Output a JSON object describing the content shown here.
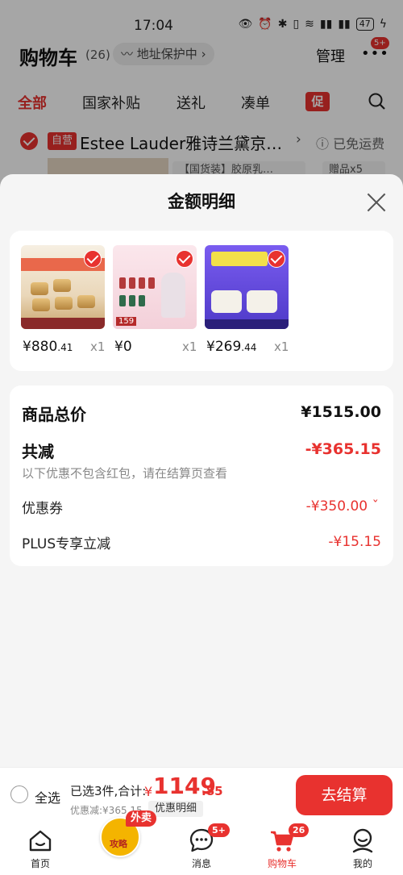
{
  "status_bar": {
    "time": "17:04",
    "battery": "47"
  },
  "header": {
    "title": "购物车",
    "count": "(26)",
    "address_protect": "地址保护中",
    "manage": "管理",
    "more_badge": "5+"
  },
  "filter_tabs": [
    {
      "label": "全部",
      "active": true
    },
    {
      "label": "国家补贴"
    },
    {
      "label": "送礼"
    },
    {
      "label": "凑单"
    }
  ],
  "promo_tag": "促",
  "store": {
    "tag": "自营",
    "name": "Estee Lauder雅诗兰黛京…",
    "shipping": "已免运费",
    "spec": "【国货装】胶原乳…",
    "gift": "赠品x5"
  },
  "sheet": {
    "title": "金额明细",
    "items": [
      {
        "price_int": "¥880",
        "price_dec": ".41",
        "qty": "x1"
      },
      {
        "price_int": "¥0",
        "price_dec": "",
        "qty": "x1"
      },
      {
        "price_int": "¥269",
        "price_dec": ".44",
        "qty": "x1"
      }
    ],
    "total_label": "商品总价",
    "total_value": "¥1515.00",
    "reduction_label": "共减",
    "reduction_value": "-¥365.15",
    "reduction_note": "以下优惠不包含红包，请在结算页查看",
    "coupon_label": "优惠券",
    "coupon_value": "-¥350.00",
    "plus_label": "PLUS专享立减",
    "plus_value": "-¥15.15"
  },
  "checkout": {
    "select_all": "全选",
    "selected_text": "已选3件,合计:",
    "currency": "¥",
    "total_int": "1149",
    "total_dec": ".85",
    "discount_text": "优惠减:¥365.15",
    "detail_label": "优惠明细",
    "button": "去结算"
  },
  "tabbar": {
    "home": "首页",
    "mid_tag": "外卖",
    "mid_label": "攻略",
    "messages": "消息",
    "messages_badge": "5+",
    "cart": "购物车",
    "cart_badge": "26",
    "mine": "我的"
  },
  "colors": {
    "accent": "#e8322f"
  }
}
